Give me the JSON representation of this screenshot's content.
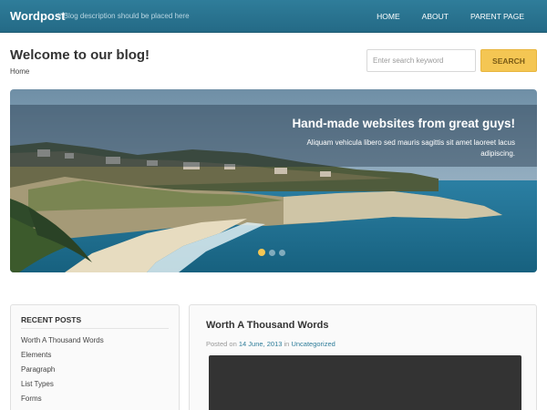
{
  "header": {
    "logo": "Wordpost",
    "tagline": "// Blog description should be placed here",
    "nav": [
      "HOME",
      "ABOUT",
      "PARENT PAGE"
    ]
  },
  "page": {
    "title": "Welcome to our blog!",
    "breadcrumb": "Home"
  },
  "search": {
    "placeholder": "Enter search keyword",
    "button_label": "SEARCH"
  },
  "slider": {
    "title": "Hand-made websites from great guys!",
    "text": "Aliquam vehicula libero sed mauris sagittis sit amet laoreet lacus adipiscing.",
    "dot_count": 3,
    "active_dot": 0
  },
  "sidebar": {
    "title": "RECENT POSTS",
    "items": [
      "Worth A Thousand Words",
      "Elements",
      "Paragraph",
      "List Types",
      "Forms"
    ]
  },
  "post": {
    "title": "Worth A Thousand Words",
    "posted_on": "Posted on",
    "date": "14 June, 2013",
    "in": "in",
    "category": "Uncategorized"
  },
  "colors": {
    "header": "#2f7d9a",
    "accent": "#f4c653",
    "link": "#2f7d9a"
  }
}
